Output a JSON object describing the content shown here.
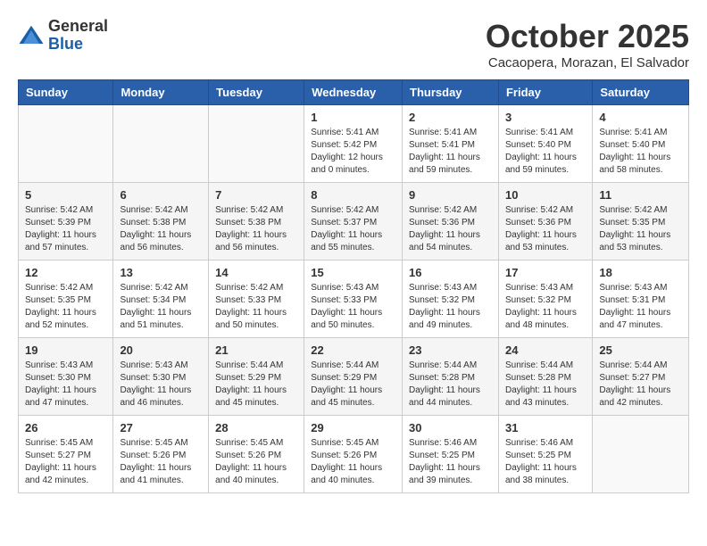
{
  "header": {
    "logo": {
      "general": "General",
      "blue": "Blue"
    },
    "title": "October 2025",
    "location": "Cacaopera, Morazan, El Salvador"
  },
  "weekdays": [
    "Sunday",
    "Monday",
    "Tuesday",
    "Wednesday",
    "Thursday",
    "Friday",
    "Saturday"
  ],
  "weeks": [
    [
      {
        "day": "",
        "info": ""
      },
      {
        "day": "",
        "info": ""
      },
      {
        "day": "",
        "info": ""
      },
      {
        "day": "1",
        "info": "Sunrise: 5:41 AM\nSunset: 5:42 PM\nDaylight: 12 hours\nand 0 minutes."
      },
      {
        "day": "2",
        "info": "Sunrise: 5:41 AM\nSunset: 5:41 PM\nDaylight: 11 hours\nand 59 minutes."
      },
      {
        "day": "3",
        "info": "Sunrise: 5:41 AM\nSunset: 5:40 PM\nDaylight: 11 hours\nand 59 minutes."
      },
      {
        "day": "4",
        "info": "Sunrise: 5:41 AM\nSunset: 5:40 PM\nDaylight: 11 hours\nand 58 minutes."
      }
    ],
    [
      {
        "day": "5",
        "info": "Sunrise: 5:42 AM\nSunset: 5:39 PM\nDaylight: 11 hours\nand 57 minutes."
      },
      {
        "day": "6",
        "info": "Sunrise: 5:42 AM\nSunset: 5:38 PM\nDaylight: 11 hours\nand 56 minutes."
      },
      {
        "day": "7",
        "info": "Sunrise: 5:42 AM\nSunset: 5:38 PM\nDaylight: 11 hours\nand 56 minutes."
      },
      {
        "day": "8",
        "info": "Sunrise: 5:42 AM\nSunset: 5:37 PM\nDaylight: 11 hours\nand 55 minutes."
      },
      {
        "day": "9",
        "info": "Sunrise: 5:42 AM\nSunset: 5:36 PM\nDaylight: 11 hours\nand 54 minutes."
      },
      {
        "day": "10",
        "info": "Sunrise: 5:42 AM\nSunset: 5:36 PM\nDaylight: 11 hours\nand 53 minutes."
      },
      {
        "day": "11",
        "info": "Sunrise: 5:42 AM\nSunset: 5:35 PM\nDaylight: 11 hours\nand 53 minutes."
      }
    ],
    [
      {
        "day": "12",
        "info": "Sunrise: 5:42 AM\nSunset: 5:35 PM\nDaylight: 11 hours\nand 52 minutes."
      },
      {
        "day": "13",
        "info": "Sunrise: 5:42 AM\nSunset: 5:34 PM\nDaylight: 11 hours\nand 51 minutes."
      },
      {
        "day": "14",
        "info": "Sunrise: 5:42 AM\nSunset: 5:33 PM\nDaylight: 11 hours\nand 50 minutes."
      },
      {
        "day": "15",
        "info": "Sunrise: 5:43 AM\nSunset: 5:33 PM\nDaylight: 11 hours\nand 50 minutes."
      },
      {
        "day": "16",
        "info": "Sunrise: 5:43 AM\nSunset: 5:32 PM\nDaylight: 11 hours\nand 49 minutes."
      },
      {
        "day": "17",
        "info": "Sunrise: 5:43 AM\nSunset: 5:32 PM\nDaylight: 11 hours\nand 48 minutes."
      },
      {
        "day": "18",
        "info": "Sunrise: 5:43 AM\nSunset: 5:31 PM\nDaylight: 11 hours\nand 47 minutes."
      }
    ],
    [
      {
        "day": "19",
        "info": "Sunrise: 5:43 AM\nSunset: 5:30 PM\nDaylight: 11 hours\nand 47 minutes."
      },
      {
        "day": "20",
        "info": "Sunrise: 5:43 AM\nSunset: 5:30 PM\nDaylight: 11 hours\nand 46 minutes."
      },
      {
        "day": "21",
        "info": "Sunrise: 5:44 AM\nSunset: 5:29 PM\nDaylight: 11 hours\nand 45 minutes."
      },
      {
        "day": "22",
        "info": "Sunrise: 5:44 AM\nSunset: 5:29 PM\nDaylight: 11 hours\nand 45 minutes."
      },
      {
        "day": "23",
        "info": "Sunrise: 5:44 AM\nSunset: 5:28 PM\nDaylight: 11 hours\nand 44 minutes."
      },
      {
        "day": "24",
        "info": "Sunrise: 5:44 AM\nSunset: 5:28 PM\nDaylight: 11 hours\nand 43 minutes."
      },
      {
        "day": "25",
        "info": "Sunrise: 5:44 AM\nSunset: 5:27 PM\nDaylight: 11 hours\nand 42 minutes."
      }
    ],
    [
      {
        "day": "26",
        "info": "Sunrise: 5:45 AM\nSunset: 5:27 PM\nDaylight: 11 hours\nand 42 minutes."
      },
      {
        "day": "27",
        "info": "Sunrise: 5:45 AM\nSunset: 5:26 PM\nDaylight: 11 hours\nand 41 minutes."
      },
      {
        "day": "28",
        "info": "Sunrise: 5:45 AM\nSunset: 5:26 PM\nDaylight: 11 hours\nand 40 minutes."
      },
      {
        "day": "29",
        "info": "Sunrise: 5:45 AM\nSunset: 5:26 PM\nDaylight: 11 hours\nand 40 minutes."
      },
      {
        "day": "30",
        "info": "Sunrise: 5:46 AM\nSunset: 5:25 PM\nDaylight: 11 hours\nand 39 minutes."
      },
      {
        "day": "31",
        "info": "Sunrise: 5:46 AM\nSunset: 5:25 PM\nDaylight: 11 hours\nand 38 minutes."
      },
      {
        "day": "",
        "info": ""
      }
    ]
  ]
}
